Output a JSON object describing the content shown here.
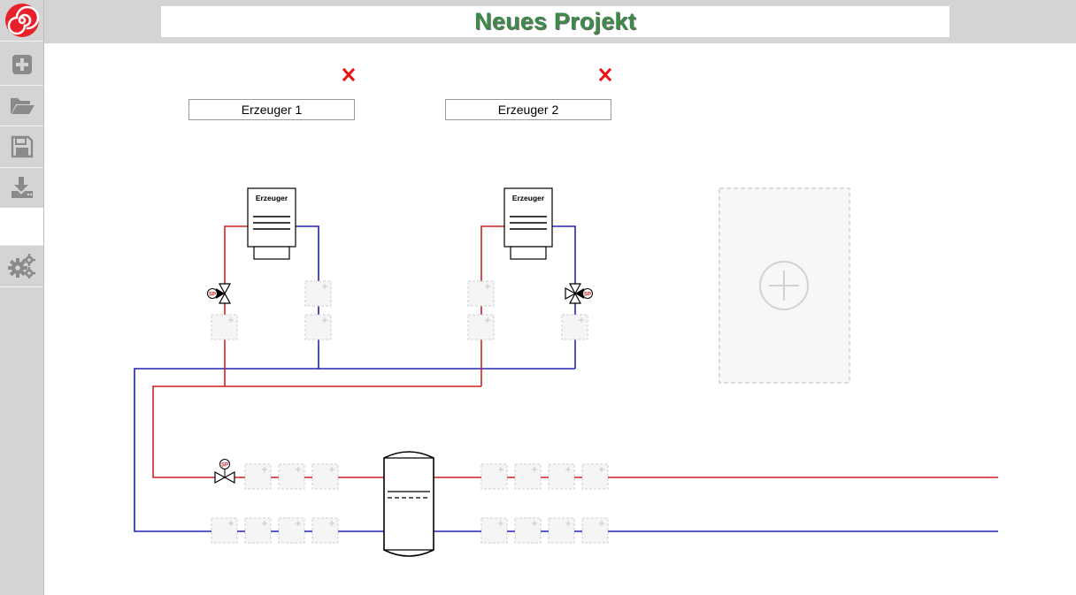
{
  "project": {
    "title": "Neues Projekt"
  },
  "sidebar": {
    "items": [
      {
        "name": "logo",
        "icon": "spiral-logo-icon"
      },
      {
        "name": "new",
        "icon": "plus-square-icon"
      },
      {
        "name": "open",
        "icon": "folder-open-icon"
      },
      {
        "name": "save",
        "icon": "floppy-disk-icon"
      },
      {
        "name": "download",
        "icon": "download-icon"
      },
      {
        "name": "settings",
        "icon": "gears-icon"
      }
    ]
  },
  "generators": [
    {
      "name": "Erzeuger 1",
      "box_label": "Erzeuger",
      "remove_icon": "close-icon"
    },
    {
      "name": "Erzeuger 2",
      "box_label": "Erzeuger",
      "remove_icon": "close-icon"
    }
  ],
  "valve_label": "SP",
  "colors": {
    "title_green": "#3f8a4a",
    "supply_line": "#cc2222",
    "return_line": "#2222bb",
    "remove_red": "#ee1111",
    "sidebar_bg": "#d4d4d4"
  }
}
